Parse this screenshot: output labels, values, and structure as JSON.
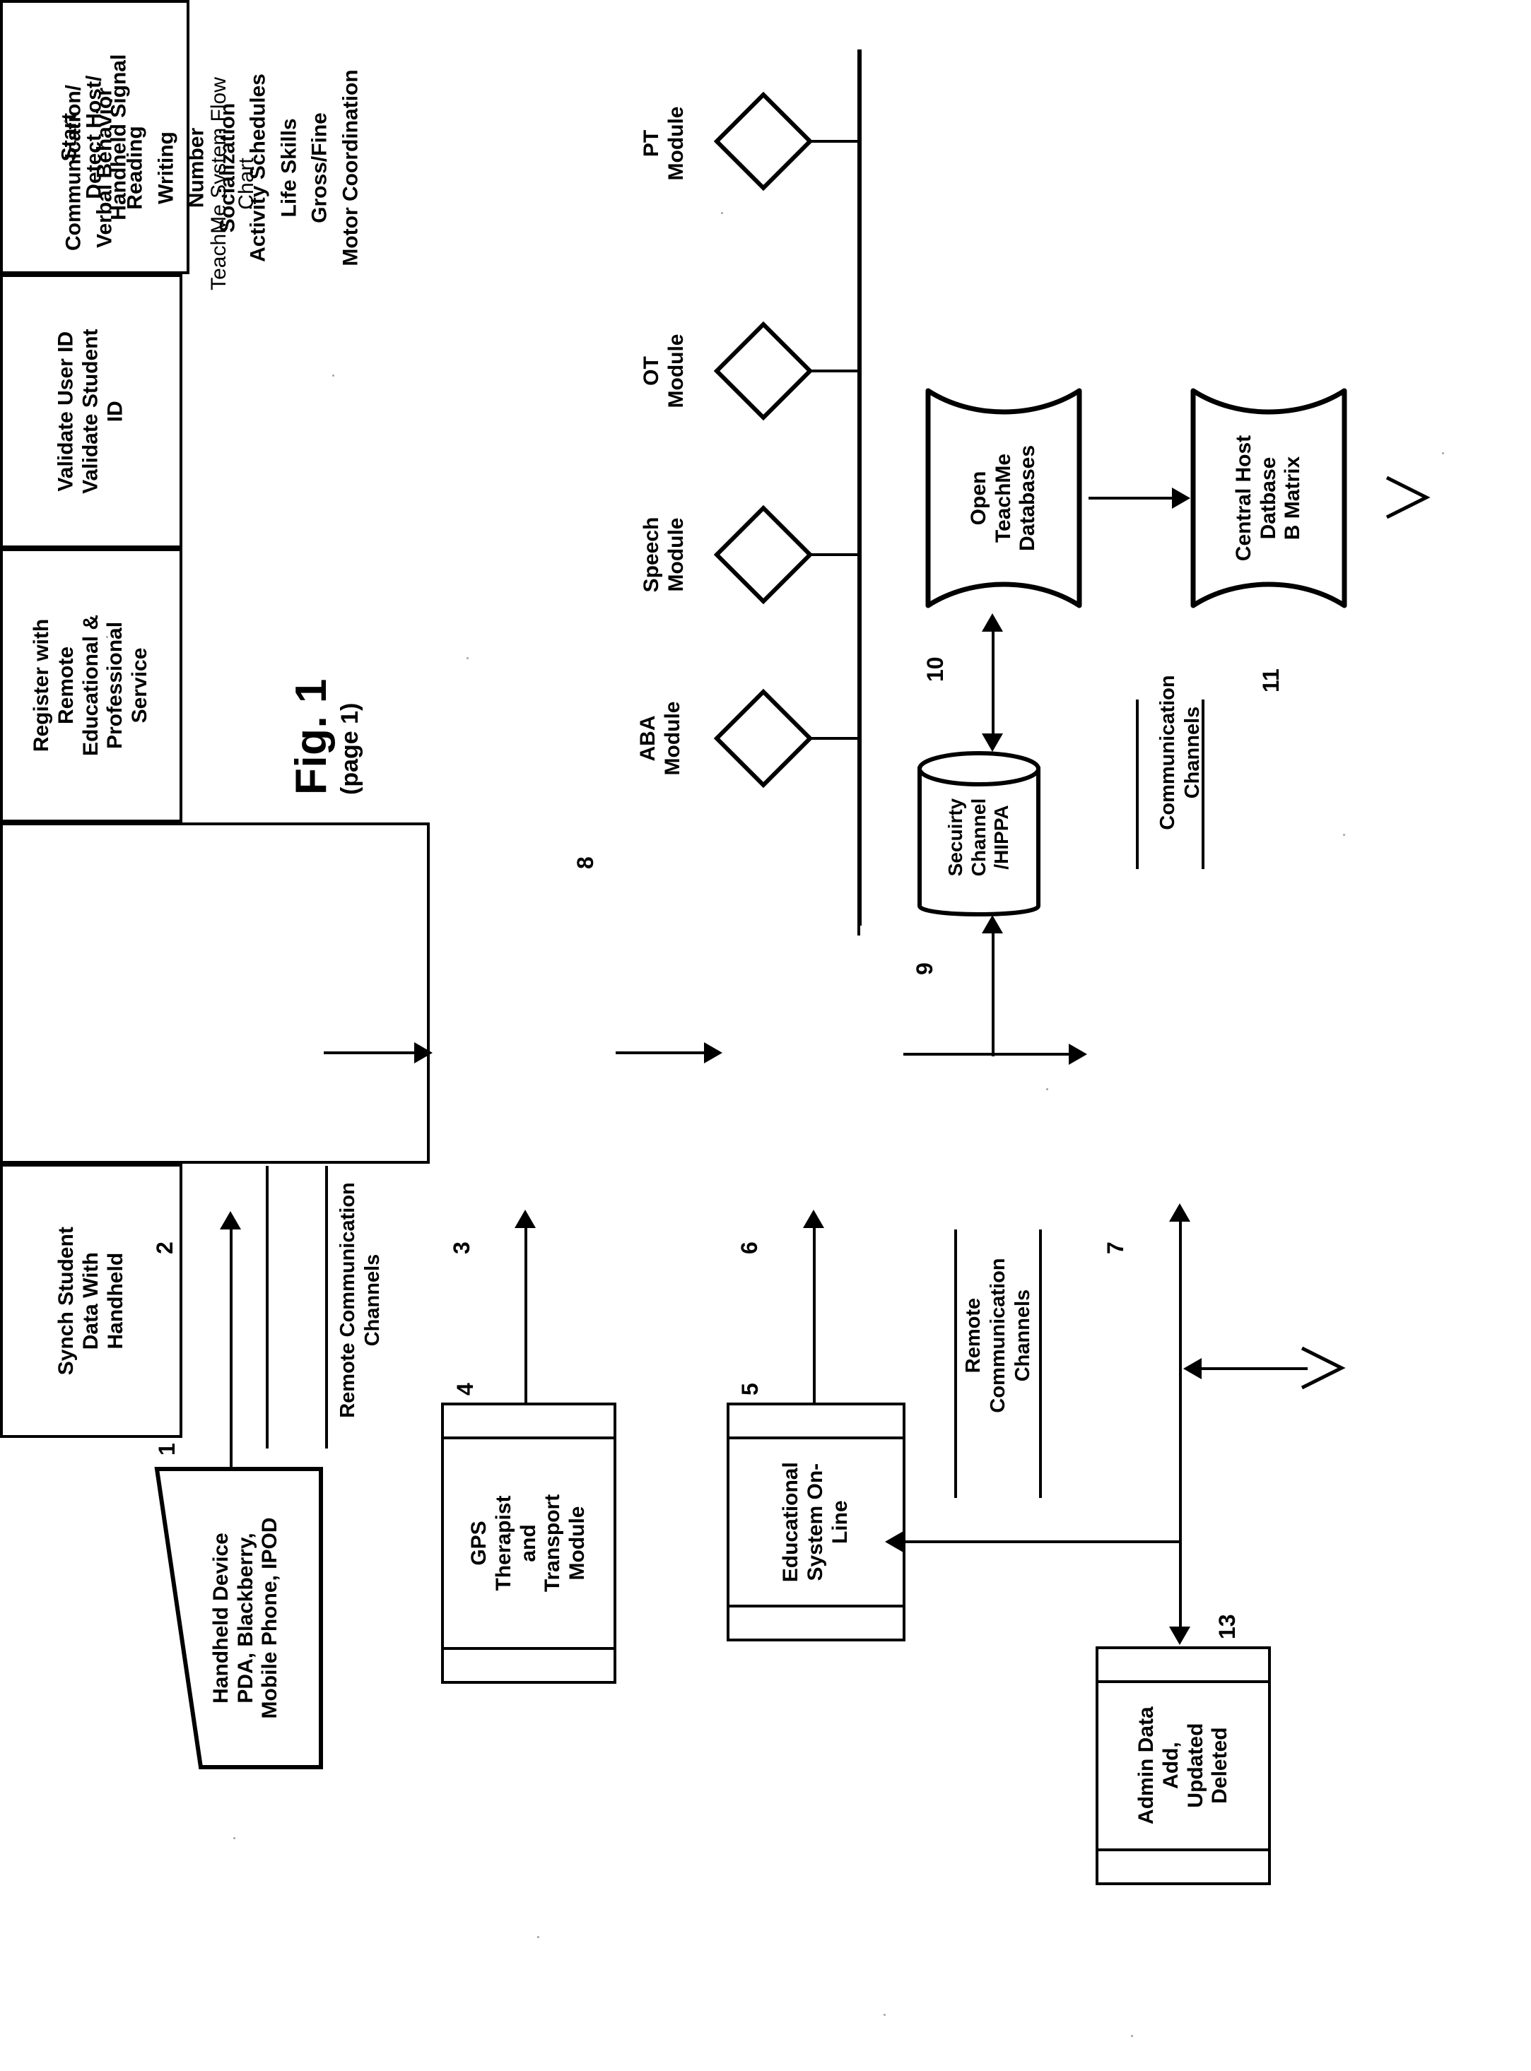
{
  "figure": {
    "number_label": "Fig. 1",
    "page_label": "(page 1)",
    "title_line1": "TeachMe System Flow",
    "title_line2": "Chart"
  },
  "nodes": {
    "handheld_device": {
      "ref": "1",
      "lines": [
        "Handheld Device",
        "PDA, Blackberry,",
        "Mobile Phone, IPOD"
      ]
    },
    "start_detect": {
      "ref": "2",
      "lines": [
        "Start",
        "Detect Host/",
        "Handheld Signal"
      ]
    },
    "validate_user": {
      "ref": "3",
      "lines": [
        "Validate User ID",
        "Validate Student",
        "ID"
      ]
    },
    "gps_module": {
      "ref": "4",
      "lines": [
        "GPS",
        "Therapist",
        "and",
        "Transport",
        "Module"
      ]
    },
    "edu_online": {
      "ref": "5",
      "lines": [
        "Educational",
        "System On-",
        "Line"
      ]
    },
    "register_remote": {
      "ref": "6",
      "lines": [
        "Register with",
        "Remote",
        "Educational &",
        "Professional",
        "Service"
      ]
    },
    "synch_student": {
      "ref": "7",
      "lines": [
        "Synch Student",
        "Data With",
        "Handheld"
      ]
    },
    "security_channel": {
      "ref": "9",
      "lines": [
        "Secuirty",
        "Channel",
        "/HIPPA"
      ]
    },
    "open_databases": {
      "ref": "10",
      "lines": [
        "Open",
        "TeachMe",
        "Databases"
      ]
    },
    "central_host": {
      "ref": "11",
      "lines": [
        "Central Host",
        "Datbase",
        "B Matrix"
      ]
    },
    "admin_data": {
      "ref": "13",
      "lines": [
        "Admin Data",
        "Add,",
        "Updated",
        "Deleted"
      ]
    },
    "skills_list": {
      "lines": [
        "Communication/",
        "Verbal Behavior",
        "Reading",
        "Writing",
        "Number",
        "Socialization",
        "Activity Schedules",
        "Life Skills",
        "Gross/Fine",
        "Motor Coordination"
      ]
    }
  },
  "modules": {
    "bus_ref": "8",
    "items": [
      {
        "line1": "ABA",
        "line2": "Module"
      },
      {
        "line1": "Speech",
        "line2": "Module"
      },
      {
        "line1": "OT",
        "line2": "Module"
      },
      {
        "line1": "PT",
        "line2": "Module"
      }
    ]
  },
  "annotations": {
    "remote_comm_top": {
      "line1": "Remote Communication",
      "line2": "Channels"
    },
    "remote_comm_mid": {
      "line1": "Remote",
      "line2": "Communication",
      "line3": "Channels"
    },
    "comm_channels_right": {
      "line1": "Communication",
      "line2": "Channels"
    }
  },
  "colors": {
    "ink": "#000000",
    "paper": "#ffffff"
  }
}
